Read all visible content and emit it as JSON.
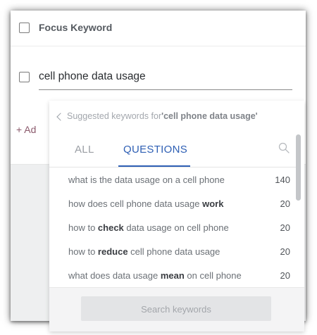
{
  "focus": {
    "label": "Focus Keyword",
    "checked": false
  },
  "keyword": {
    "value": "cell phone data usage",
    "checked": false
  },
  "add_link": "+ Ad",
  "dropdown": {
    "header_prefix": "Suggested keywords for ",
    "header_query": "'cell phone data usage'",
    "tabs": [
      {
        "label": "ALL",
        "active": false
      },
      {
        "label": "QUESTIONS",
        "active": true
      }
    ],
    "items": [
      {
        "parts": [
          {
            "t": "what is the data usage on a cell phone",
            "b": false
          }
        ],
        "count": "140"
      },
      {
        "parts": [
          {
            "t": "how does cell phone data usage ",
            "b": false
          },
          {
            "t": "work",
            "b": true
          }
        ],
        "count": "20"
      },
      {
        "parts": [
          {
            "t": "how to ",
            "b": false
          },
          {
            "t": "check",
            "b": true
          },
          {
            "t": " data usage on cell phone",
            "b": false
          }
        ],
        "count": "20"
      },
      {
        "parts": [
          {
            "t": "how to ",
            "b": false
          },
          {
            "t": "reduce",
            "b": true
          },
          {
            "t": " cell phone data usage",
            "b": false
          }
        ],
        "count": "20"
      },
      {
        "parts": [
          {
            "t": "what does data usage ",
            "b": false
          },
          {
            "t": "mean",
            "b": true
          },
          {
            "t": " on cell phone",
            "b": false
          }
        ],
        "count": "20"
      }
    ],
    "search_button": "Search keywords"
  },
  "colors": {
    "accent": "#2e5fb4",
    "panel_bg": "#eeeff0",
    "link": "#8b5a6c"
  },
  "icons": {
    "back": "chevron-left-icon",
    "search": "search-icon"
  }
}
